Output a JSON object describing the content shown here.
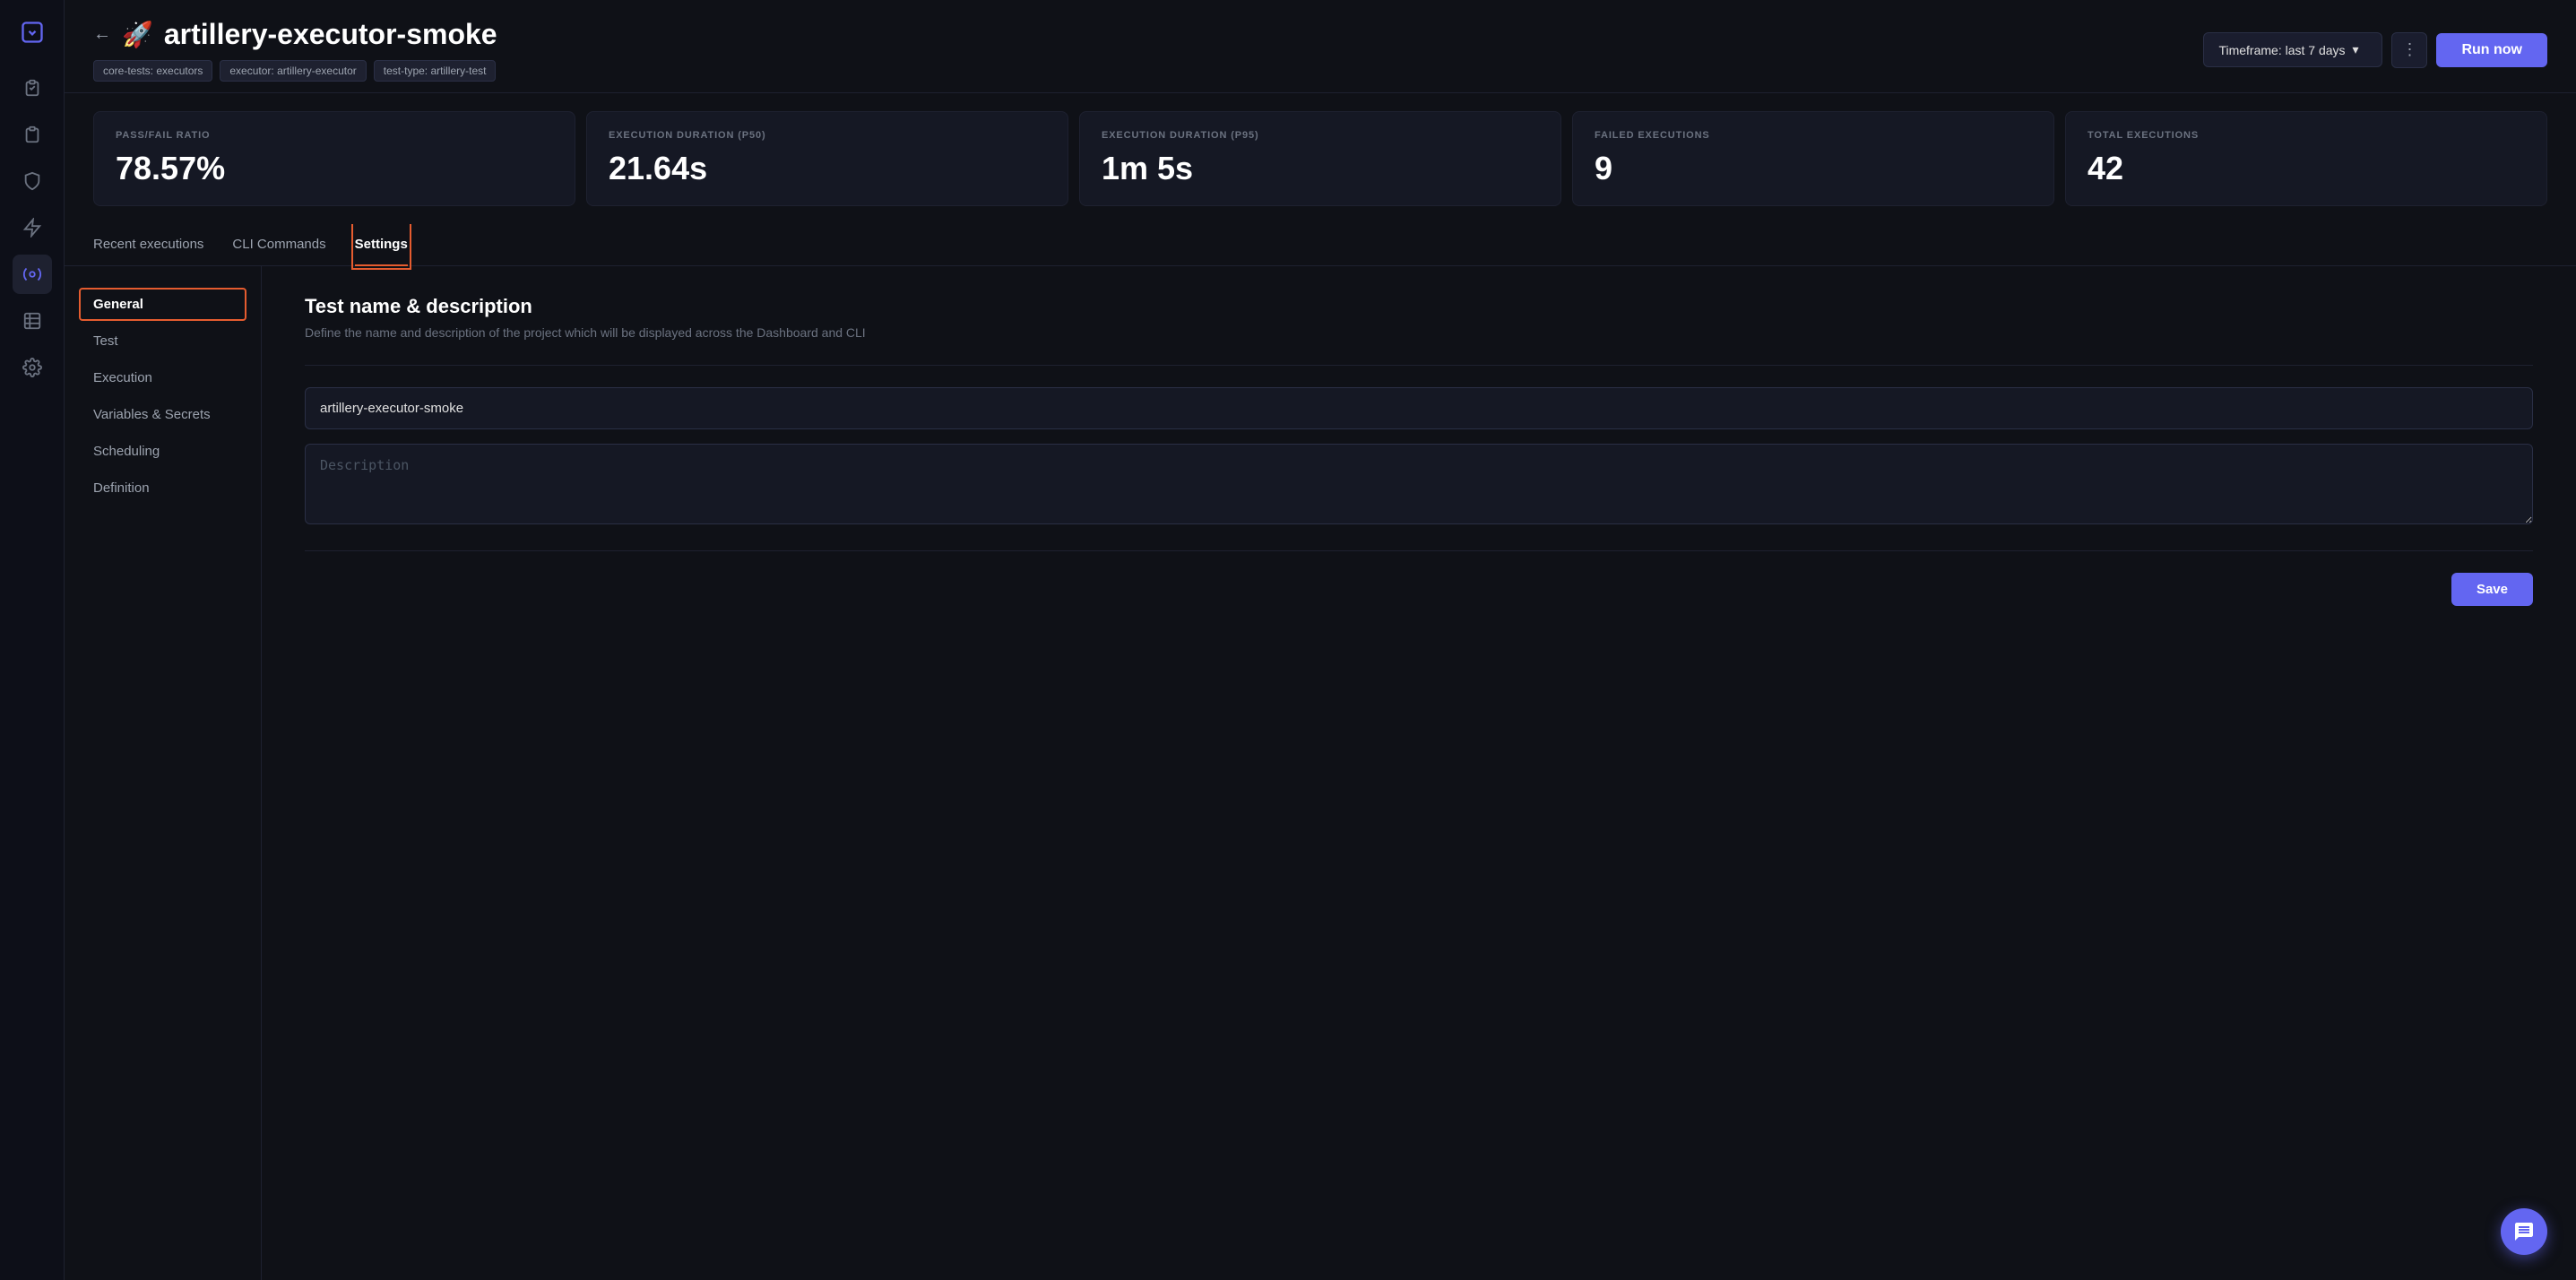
{
  "sidebar": {
    "items": [
      {
        "name": "clipboard-icon",
        "icon": "☑",
        "active": false
      },
      {
        "name": "stack-icon",
        "icon": "⧉",
        "active": false
      },
      {
        "name": "shield-icon",
        "icon": "🛡",
        "active": false
      },
      {
        "name": "lightning-icon",
        "icon": "⚡",
        "active": false
      },
      {
        "name": "gear-circle-icon",
        "icon": "⚙",
        "active": true
      },
      {
        "name": "table-icon",
        "icon": "▤",
        "active": false
      },
      {
        "name": "settings-icon",
        "icon": "⚙",
        "active": false
      }
    ]
  },
  "header": {
    "back_label": "←",
    "title_icon": "🚀",
    "title": "artillery-executor-smoke",
    "tags": [
      {
        "label": "core-tests: executors"
      },
      {
        "label": "executor: artillery-executor"
      },
      {
        "label": "test-type: artillery-test"
      }
    ],
    "timeframe_label": "Timeframe: last 7 days",
    "more_icon": "⋮",
    "run_now_label": "Run now"
  },
  "stats": [
    {
      "label": "PASS/FAIL RATIO",
      "value": "78.57%"
    },
    {
      "label": "EXECUTION DURATION (P50)",
      "value": "21.64s"
    },
    {
      "label": "EXECUTION DURATION (P95)",
      "value": "1m 5s"
    },
    {
      "label": "FAILED EXECUTIONS",
      "value": "9"
    },
    {
      "label": "TOTAL EXECUTIONS",
      "value": "42"
    }
  ],
  "tabs": [
    {
      "label": "Recent executions",
      "active": false
    },
    {
      "label": "CLI Commands",
      "active": false
    },
    {
      "label": "Settings",
      "active": true
    }
  ],
  "settings_nav": [
    {
      "label": "General",
      "active": true
    },
    {
      "label": "Test",
      "active": false
    },
    {
      "label": "Execution",
      "active": false
    },
    {
      "label": "Variables & Secrets",
      "active": false
    },
    {
      "label": "Scheduling",
      "active": false
    },
    {
      "label": "Definition",
      "active": false
    }
  ],
  "settings_section": {
    "title": "Test name & description",
    "description": "Define the name and description of the project which will be displayed across the Dashboard and CLI",
    "name_value": "artillery-executor-smoke",
    "description_placeholder": "Description",
    "save_label": "Save"
  },
  "chat_icon": "💬"
}
